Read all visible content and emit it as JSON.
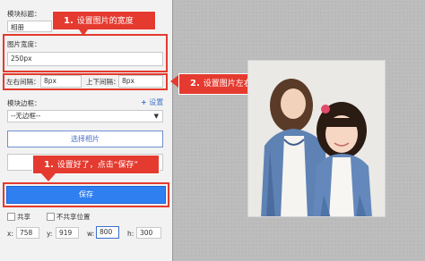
{
  "panel": {
    "module_title_label": "模块标题：",
    "module_title_value": "相册",
    "image_width_label": "图片宽度：",
    "image_width_value": "250px",
    "lr_spacing_label": "左右间隔：",
    "lr_spacing_value": "8px",
    "tb_spacing_label": "上下间隔：",
    "tb_spacing_value": "8px",
    "border_label": "模块边框：",
    "settings_link": "设置",
    "border_select_value": "--无边框--",
    "choose_photo_button": "选择相片",
    "save_button": "保存",
    "shared_label": "共享",
    "no_shared_position_label": "不共享位置",
    "coords": {
      "x_label": "x:",
      "x_value": "758",
      "y_label": "y:",
      "y_value": "919",
      "w_label": "w:",
      "w_value": "800",
      "h_label": "h:",
      "h_value": "300"
    }
  },
  "callouts": {
    "c1_num": "1.",
    "c1_text": "设置图片的宽度",
    "c2_num": "2.",
    "c2_text": "设置图片左右和上下间隔",
    "c3_num": "1.",
    "c3_text": "设置好了，点击“保存”"
  },
  "colors": {
    "accent_red": "#e53a2f",
    "primary_blue": "#2f7ff0"
  },
  "icons": {
    "settings": "plus-circle-icon",
    "dropdown": "caret-down-icon"
  }
}
